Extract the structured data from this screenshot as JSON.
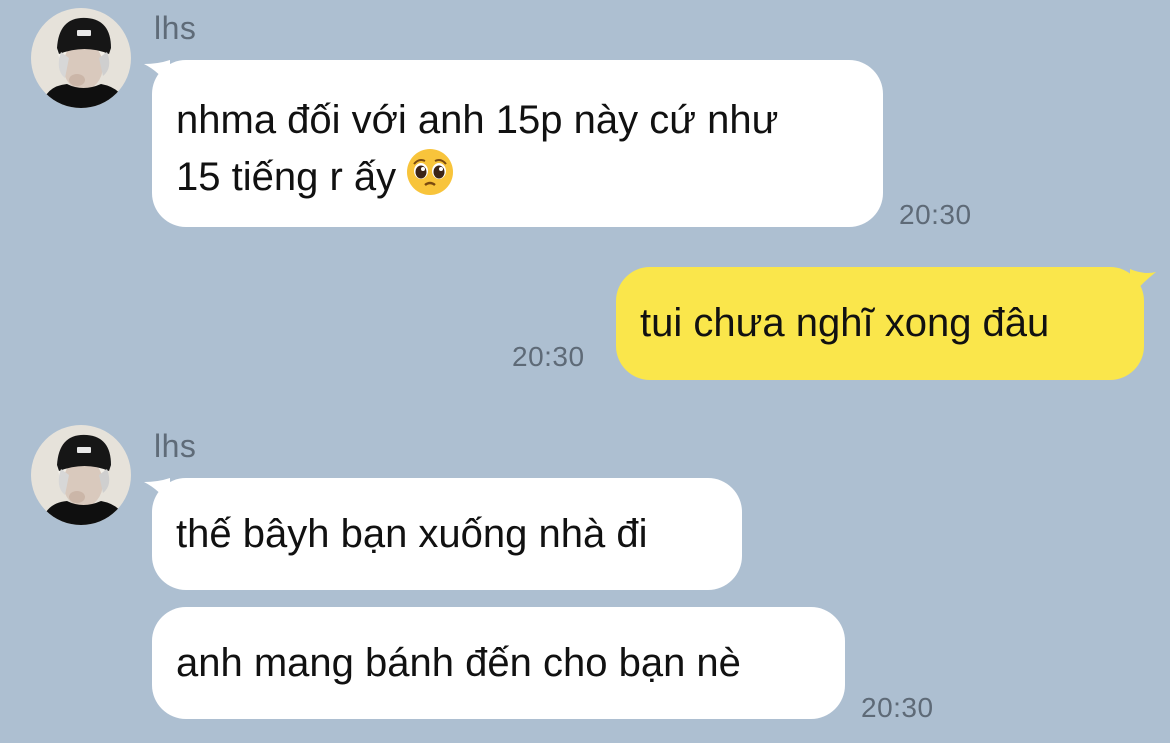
{
  "chat": {
    "messages": [
      {
        "sender": "lhs",
        "text_line1": "nhma đối với anh 15p này cứ như",
        "text_line2": "15 tiếng r ấy",
        "emoji": "pleading-face-icon",
        "time": "20:30"
      },
      {
        "sender": "me",
        "text": "tui chưa nghĩ xong đâu",
        "time": "20:30"
      },
      {
        "sender": "lhs",
        "text": "thế bâyh bạn xuống nhà đi"
      },
      {
        "sender": "lhs",
        "text": "anh mang bánh đến cho bạn nè",
        "time": "20:30"
      }
    ]
  },
  "colors": {
    "background": "#adbfd1",
    "incoming_bubble": "#ffffff",
    "outgoing_bubble": "#fae64b",
    "time_text": "#5e6a77"
  }
}
